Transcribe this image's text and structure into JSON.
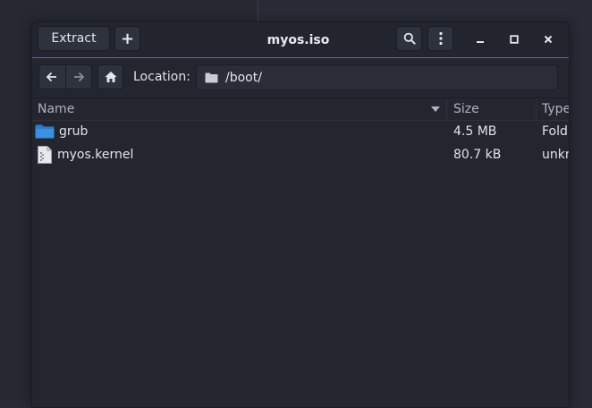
{
  "window": {
    "title": "myos.iso",
    "extract_label": "Extract",
    "add_label": "+"
  },
  "icons": {
    "add": "plus-icon",
    "search": "search-icon",
    "menu": "vertical-ellipsis-icon",
    "minimize": "minimize-icon",
    "maximize": "maximize-icon",
    "close": "close-icon",
    "back": "arrow-left-icon",
    "forward": "arrow-right-icon",
    "home": "home-icon",
    "folder": "folder-icon",
    "file": "file-icon"
  },
  "location": {
    "label": "Location:",
    "path": "/boot/"
  },
  "columns": {
    "name": "Name",
    "size": "Size",
    "type": "Type"
  },
  "files": [
    {
      "name": "grub",
      "size": "4.5 MB",
      "type": "Fold",
      "icon": "folder-icon"
    },
    {
      "name": "myos.kernel",
      "size": "80.7 kB",
      "type": "unkn",
      "icon": "file-icon"
    }
  ],
  "colors": {
    "accent": "#3a6fc0",
    "folder": "#3d8fe0",
    "window_bg": "#23262f"
  }
}
